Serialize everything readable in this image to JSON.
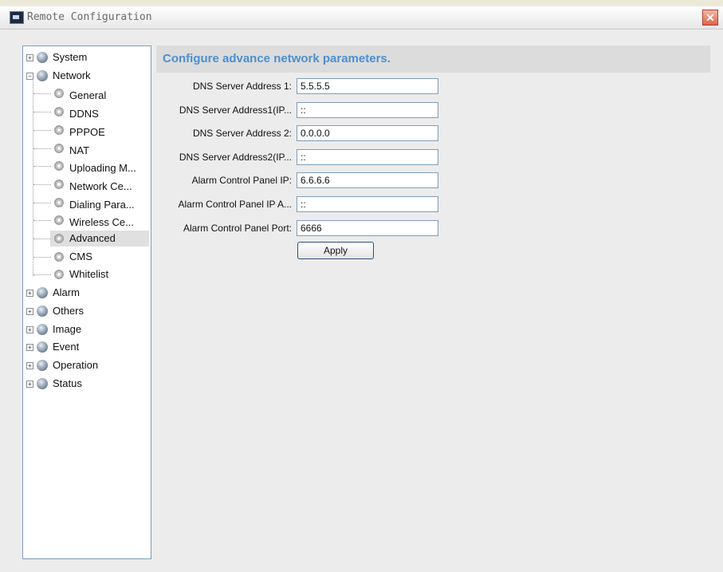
{
  "window": {
    "title": "Remote Configuration",
    "close_glyph": "✕"
  },
  "tree": {
    "collapsed_glyph": "+",
    "expanded_glyph": "−",
    "items": [
      {
        "label": "System",
        "icon": "globe-icon",
        "expander": "collapsed"
      },
      {
        "label": "Network",
        "icon": "globe-icon",
        "expander": "expanded"
      },
      {
        "label": "General",
        "icon": "gear-icon"
      },
      {
        "label": "DDNS",
        "icon": "gear-icon"
      },
      {
        "label": "PPPOE",
        "icon": "gear-icon"
      },
      {
        "label": "NAT",
        "icon": "gear-icon"
      },
      {
        "label": "Uploading M...",
        "icon": "gear-icon"
      },
      {
        "label": "Network Ce...",
        "icon": "gear-icon"
      },
      {
        "label": "Dialing Para...",
        "icon": "gear-icon"
      },
      {
        "label": "Wireless Ce...",
        "icon": "gear-icon"
      },
      {
        "label": "Advanced",
        "icon": "gear-icon",
        "selected": true
      },
      {
        "label": "CMS",
        "icon": "gear-icon"
      },
      {
        "label": "Whitelist",
        "icon": "gear-icon"
      },
      {
        "label": "Alarm",
        "icon": "globe-icon",
        "expander": "collapsed"
      },
      {
        "label": "Others",
        "icon": "globe-icon",
        "expander": "collapsed"
      },
      {
        "label": "Image",
        "icon": "globe-icon",
        "expander": "collapsed"
      },
      {
        "label": "Event",
        "icon": "globe-icon",
        "expander": "collapsed"
      },
      {
        "label": "Operation",
        "icon": "globe-icon",
        "expander": "collapsed"
      },
      {
        "label": "Status",
        "icon": "globe-icon",
        "expander": "collapsed"
      }
    ]
  },
  "main": {
    "header": "Configure advance network parameters.",
    "fields": [
      {
        "label": "DNS Server Address 1:",
        "value": "5.5.5.5"
      },
      {
        "label": "DNS Server Address1(IP...",
        "value": "::"
      },
      {
        "label": "DNS Server Address 2:",
        "value": "0.0.0.0"
      },
      {
        "label": "DNS Server Address2(IP...",
        "value": "::"
      },
      {
        "label": "Alarm Control Panel IP:",
        "value": "6.6.6.6"
      },
      {
        "label": "Alarm Control Panel IP A...",
        "value": "::"
      },
      {
        "label": "Alarm Control Panel Port:",
        "value": "6666"
      }
    ],
    "apply_label": "Apply"
  },
  "colors": {
    "header_text": "#4a90d0",
    "selected_row": "#e0e0e0"
  }
}
